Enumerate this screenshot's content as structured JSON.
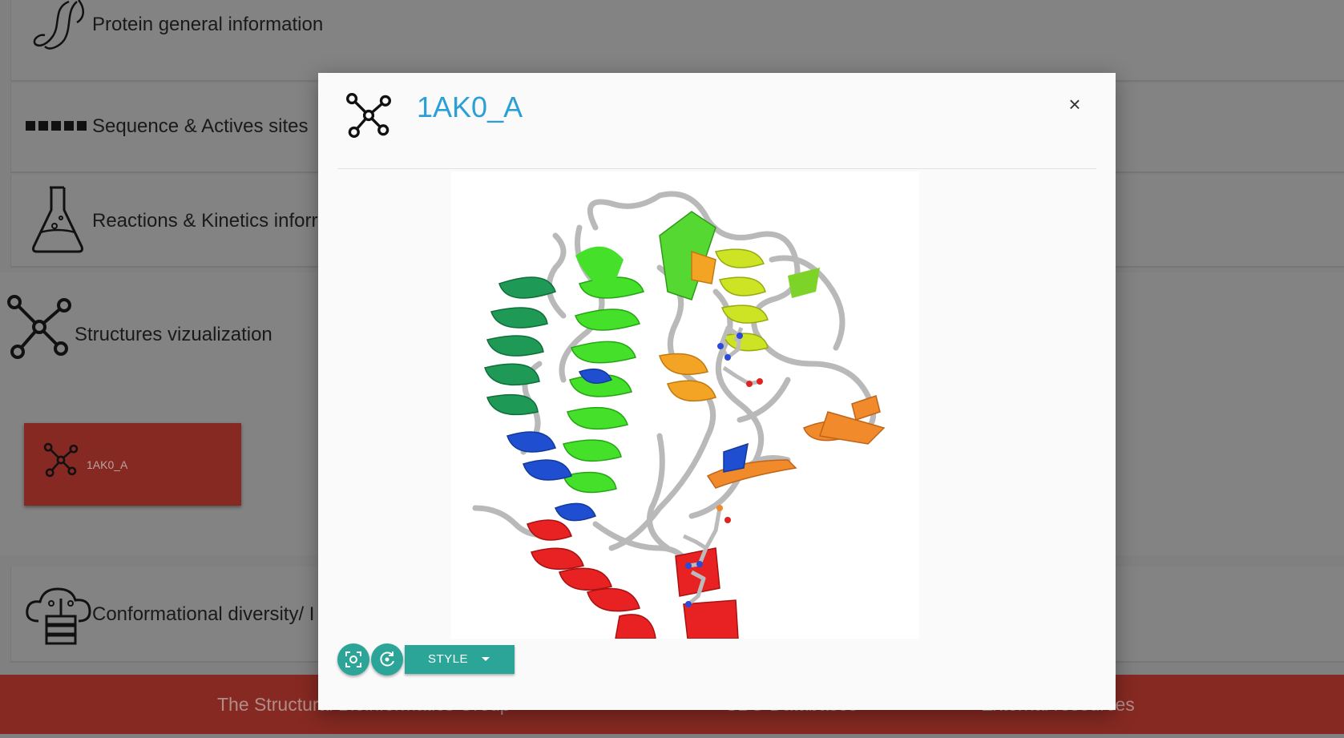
{
  "sections": {
    "protein": {
      "title": "Protein general information",
      "icon": "protein-icon"
    },
    "sequence": {
      "title": "Sequence & Actives sites",
      "icon": "sequence-blocks-icon"
    },
    "reactions": {
      "title": "Reactions & Kinetics inforr",
      "icon": "flask-icon"
    },
    "structures": {
      "title": "Structures vizualization",
      "icon": "molecule-icon"
    },
    "conformational": {
      "title": "Conformational diversity/ I",
      "icon": "cloud-server-icon"
    }
  },
  "structure_tile": {
    "label": "1AK0_A",
    "icon": "molecule-icon",
    "color": "#862922"
  },
  "footer": {
    "links": [
      "The Structural Bioinformatics Group",
      "SBG Databases",
      "External resources"
    ],
    "color": "#862922"
  },
  "modal": {
    "title": "1AK0_A",
    "close_label": "×",
    "icon": "molecule-icon",
    "title_color": "#2a9fd8",
    "controls": {
      "center_icon": "focus-center-icon",
      "rotate_icon": "rotate-icon",
      "style_label": "STYLE",
      "button_color": "#2ba597"
    },
    "viewer": {
      "image": "protein-3d-cartoon-structure"
    }
  }
}
